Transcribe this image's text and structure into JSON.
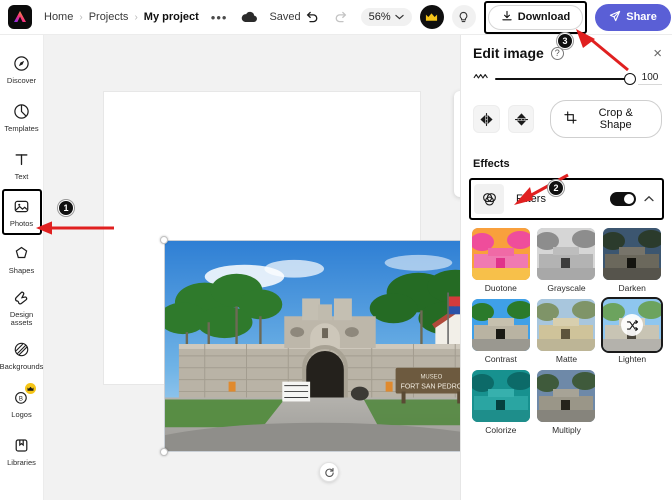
{
  "topbar": {
    "logo_icon": "adobe-express-logo",
    "breadcrumbs": [
      {
        "label": "Home",
        "active": false
      },
      {
        "label": "Projects",
        "active": false
      },
      {
        "label": "My project",
        "active": true
      }
    ],
    "separator": "›",
    "more_menu": "•••",
    "cloud_icon": "cloud-icon",
    "save_status": "Saved",
    "undo_icon": "undo-icon",
    "redo_icon": "redo-icon",
    "zoom_level": "56%",
    "zoom_caret": "⌄",
    "premium_icon": "crown-icon",
    "ideas_icon": "lightbulb-icon",
    "download_label": "Download",
    "download_icon": "download-icon",
    "share_label": "Share",
    "share_icon": "send-icon",
    "accent_color": "#5a5fd6"
  },
  "sidebar": {
    "items": [
      {
        "label": "Discover",
        "icon": "discover-icon",
        "selected": false,
        "premium": false
      },
      {
        "label": "Templates",
        "icon": "templates-icon",
        "selected": false,
        "premium": false
      },
      {
        "label": "Text",
        "icon": "text-icon",
        "selected": false,
        "premium": false
      },
      {
        "label": "Photos",
        "icon": "photos-icon",
        "selected": true,
        "premium": false
      },
      {
        "label": "Shapes",
        "icon": "shapes-icon",
        "selected": false,
        "premium": false
      },
      {
        "label": "Design assets",
        "icon": "design-assets-icon",
        "selected": false,
        "premium": false
      },
      {
        "label": "Backgrounds",
        "icon": "backgrounds-icon",
        "selected": false,
        "premium": false
      },
      {
        "label": "Logos",
        "icon": "logos-icon",
        "selected": false,
        "premium": true
      },
      {
        "label": "Libraries",
        "icon": "libraries-icon",
        "selected": false,
        "premium": false
      }
    ]
  },
  "canvas": {
    "image_caption": "FORT SAN PEDRO",
    "rotate_icon": "rotate-icon",
    "float_tools": [
      {
        "icon": "replace-image-icon",
        "name": "replace-image"
      },
      {
        "icon": "duplicate-icon",
        "name": "duplicate-layer"
      },
      {
        "icon": "trash-icon",
        "name": "delete-layer"
      }
    ]
  },
  "panel": {
    "title": "Edit image",
    "help_icon": "help-icon",
    "help_glyph": "?",
    "close_icon": "close-icon",
    "close_glyph": "×",
    "slider": {
      "icon": "opacity-icon",
      "value": "100",
      "min": 0,
      "max": 100
    },
    "flip_horizontal_icon": "flip-horizontal-icon",
    "flip_vertical_icon": "flip-vertical-icon",
    "crop_label": "Crop & Shape",
    "crop_icon": "crop-icon",
    "effects_label": "Effects",
    "filters": {
      "icon": "filters-icon",
      "label": "Filters",
      "toggle_on": true,
      "chevron": "⌃"
    },
    "filter_items": [
      {
        "label": "Duotone",
        "selected": false,
        "c1": "#f25a9e",
        "c2": "#f9a03c"
      },
      {
        "label": "Grayscale",
        "selected": false,
        "c1": "#bdbdbd",
        "c2": "#8e8e8e"
      },
      {
        "label": "Darken",
        "selected": false,
        "c1": "#3f5a72",
        "c2": "#49505a"
      },
      {
        "label": "Contrast",
        "selected": false,
        "c1": "#4aa3e8",
        "c2": "#9aa79d"
      },
      {
        "label": "Matte",
        "selected": false,
        "c1": "#b8c9b4",
        "c2": "#cfc39a"
      },
      {
        "label": "Lighten",
        "selected": true,
        "c1": "#8ec6ef",
        "c2": "#c2c8bd"
      },
      {
        "label": "Colorize",
        "selected": false,
        "c1": "#17918f",
        "c2": "#1d8b86"
      },
      {
        "label": "Multiply",
        "selected": false,
        "c1": "#6e89a8",
        "c2": "#7b7f74"
      }
    ],
    "shuffle_icon": "shuffle-icon"
  },
  "annotations": [
    {
      "number": "1",
      "target": "sidebar-item-photos"
    },
    {
      "number": "2",
      "target": "filters-row"
    },
    {
      "number": "3",
      "target": "download-button"
    }
  ]
}
